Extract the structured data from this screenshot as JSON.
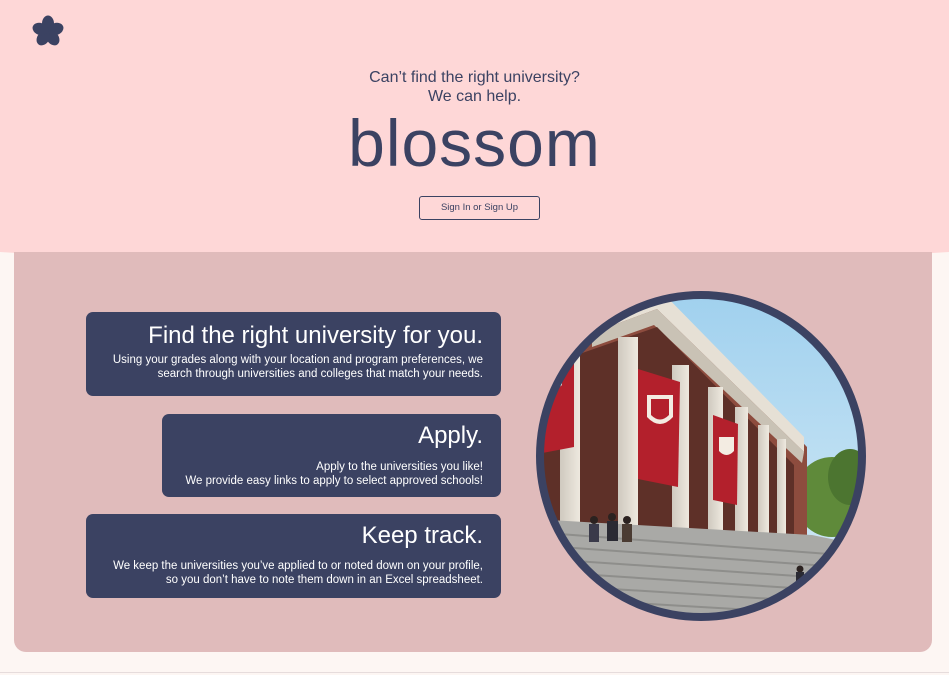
{
  "header": {
    "logo_icon": "flower-icon",
    "tagline_line1": "Can’t find the right university?",
    "tagline_line2": "We can help.",
    "brand_name": "blossom",
    "signin_label": "Sign In or Sign Up"
  },
  "features": [
    {
      "title": "Find the right university for you.",
      "line1": "Using your grades along with your location and program preferences, we",
      "line2": "search through universities and colleges that match your needs."
    },
    {
      "title": "Apply.",
      "line1": "Apply to the universities you like!",
      "line2": "We provide easy links to apply to select approved schools!"
    },
    {
      "title": "Keep track.",
      "line1": "We keep the universities you’ve applied to or noted down on your profile,",
      "line2": "so you don’t have to note them down in an Excel spreadsheet."
    }
  ],
  "image": {
    "subject": "university-building-photo"
  },
  "colors": {
    "hero_background": "#fed7d7",
    "panel_background": "#e0bbbb",
    "card_background": "#3b4262",
    "text_primary": "#3b4262",
    "banner_red": "#b3202c"
  }
}
